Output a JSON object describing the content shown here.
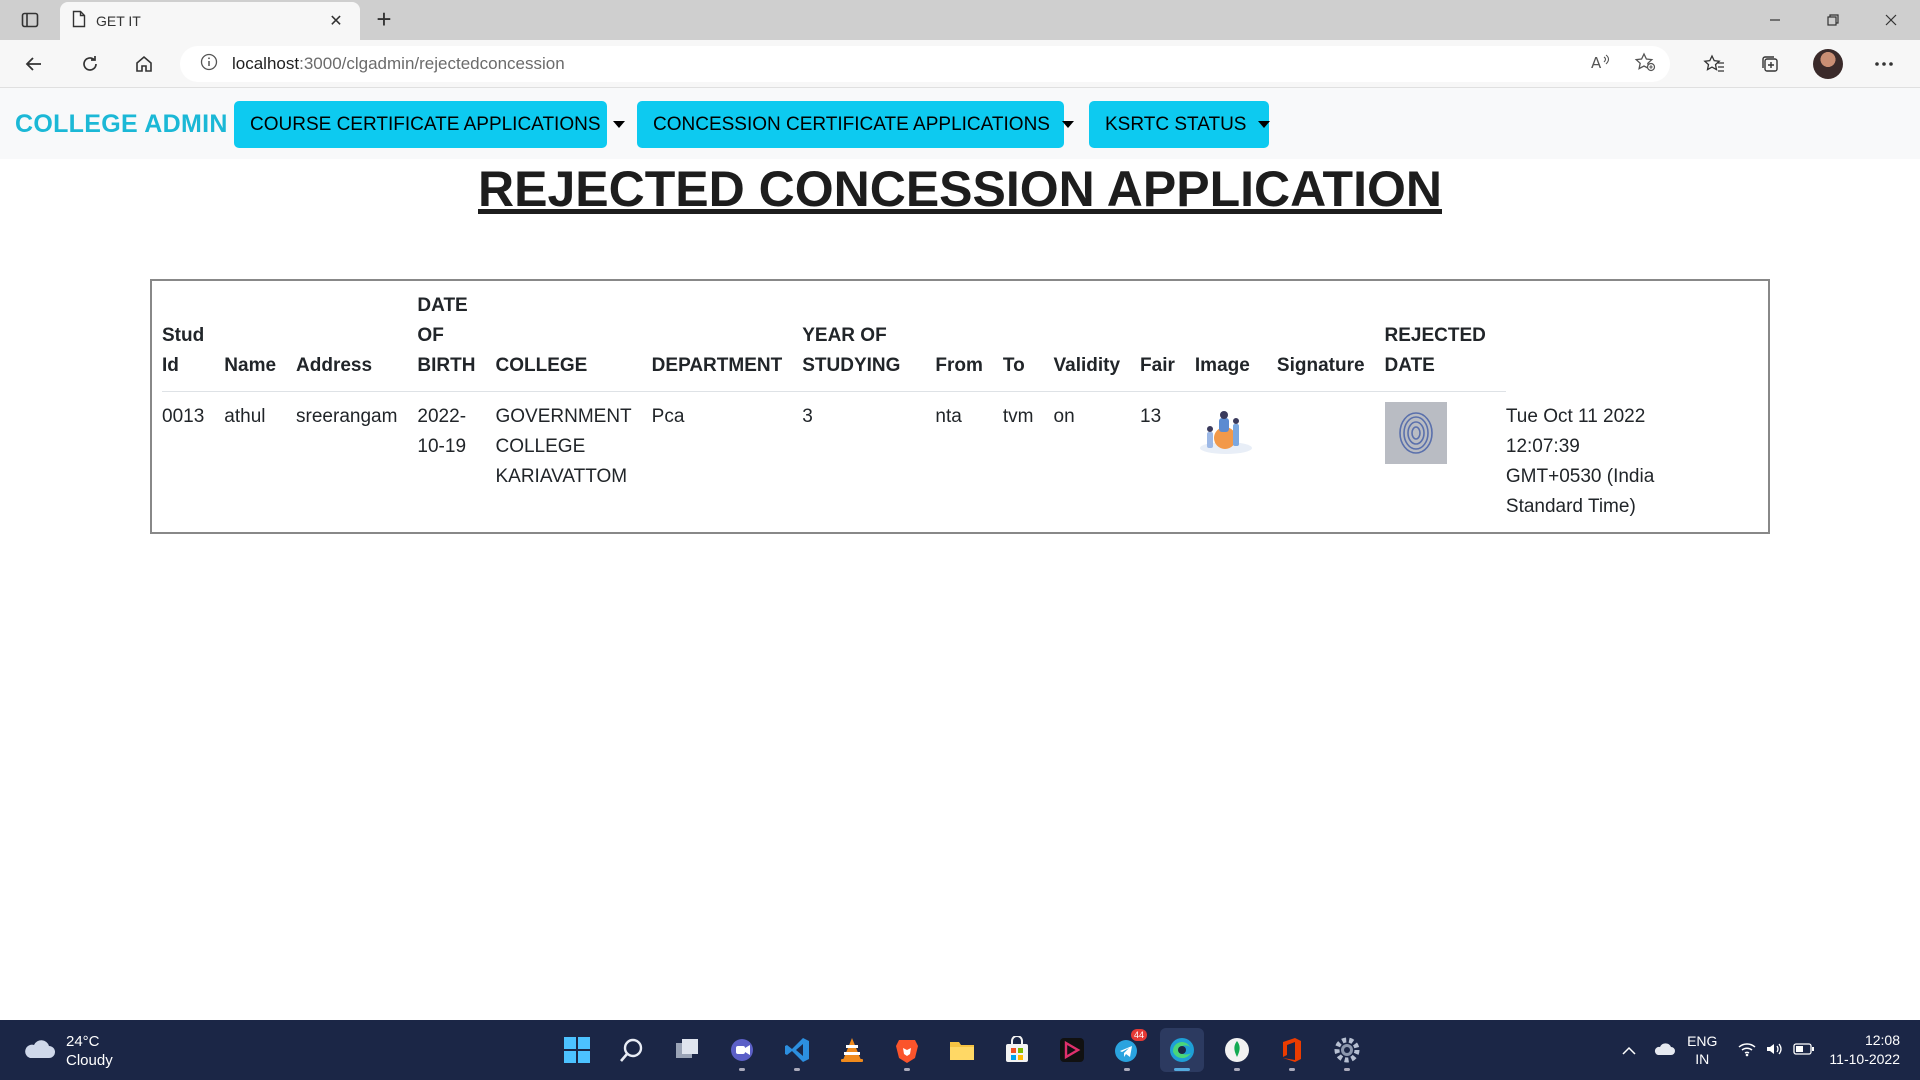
{
  "browser": {
    "tab_title": "GET IT",
    "url_host": "localhost",
    "url_rest": ":3000/clgadmin/rejectedconcession"
  },
  "navbar": {
    "brand": "COLLEGE ADMIN",
    "menus": [
      {
        "label": "COURSE CERTIFICATE APPLICATIONS"
      },
      {
        "label": "CONCESSION CERTIFICATE APPLICATIONS"
      },
      {
        "label": "KSRTC STATUS"
      }
    ],
    "button_color": "#0dcaf0",
    "brand_color": "#1bb8d6"
  },
  "page": {
    "title": "REJECTED CONCESSION APPLICATION"
  },
  "table": {
    "headers": {
      "stud_id_1": "Stud",
      "stud_id_2": "Id",
      "name": "Name",
      "address": "Address",
      "dob_1": "DATE",
      "dob_2": "OF",
      "dob_3": "BIRTH",
      "college": "COLLEGE",
      "department": "DEPARTMENT",
      "year_1": "YEAR OF",
      "year_2": "STUDYING",
      "from": "From",
      "to": "To",
      "validity": "Validity",
      "fair": "Fair",
      "image": "Image",
      "signature": "Signature",
      "rejected_1": "REJECTED",
      "rejected_2": "DATE"
    },
    "rows": [
      {
        "stud_id": "0013",
        "name": "athul",
        "address": "sreerangam",
        "dob_1": "2022-",
        "dob_2": "10-19",
        "college_1": "GOVERNMENT",
        "college_2": "COLLEGE",
        "college_3": "KARIAVATTOM",
        "department": "Pca",
        "year": "3",
        "from": "nta",
        "to": "tvm",
        "validity": "on",
        "fair": "13",
        "rejected_1": "Tue Oct 11 2022",
        "rejected_2": "12:07:39",
        "rejected_3": "GMT+0530 (India",
        "rejected_4": "Standard Time)"
      }
    ]
  },
  "taskbar": {
    "temperature": "24°C",
    "weather": "Cloudy",
    "lang_1": "ENG",
    "lang_2": "IN",
    "time": "12:08",
    "date": "11-10-2022",
    "telegram_badge": "44",
    "icons": [
      "start-icon",
      "search-icon",
      "task-view-icon",
      "teams-icon",
      "vscode-icon",
      "vlc-icon",
      "brave-icon",
      "file-explorer-icon",
      "store-icon",
      "app-icon",
      "telegram-icon",
      "edge-icon",
      "mongodb-icon",
      "office-icon",
      "settings-icon"
    ]
  }
}
